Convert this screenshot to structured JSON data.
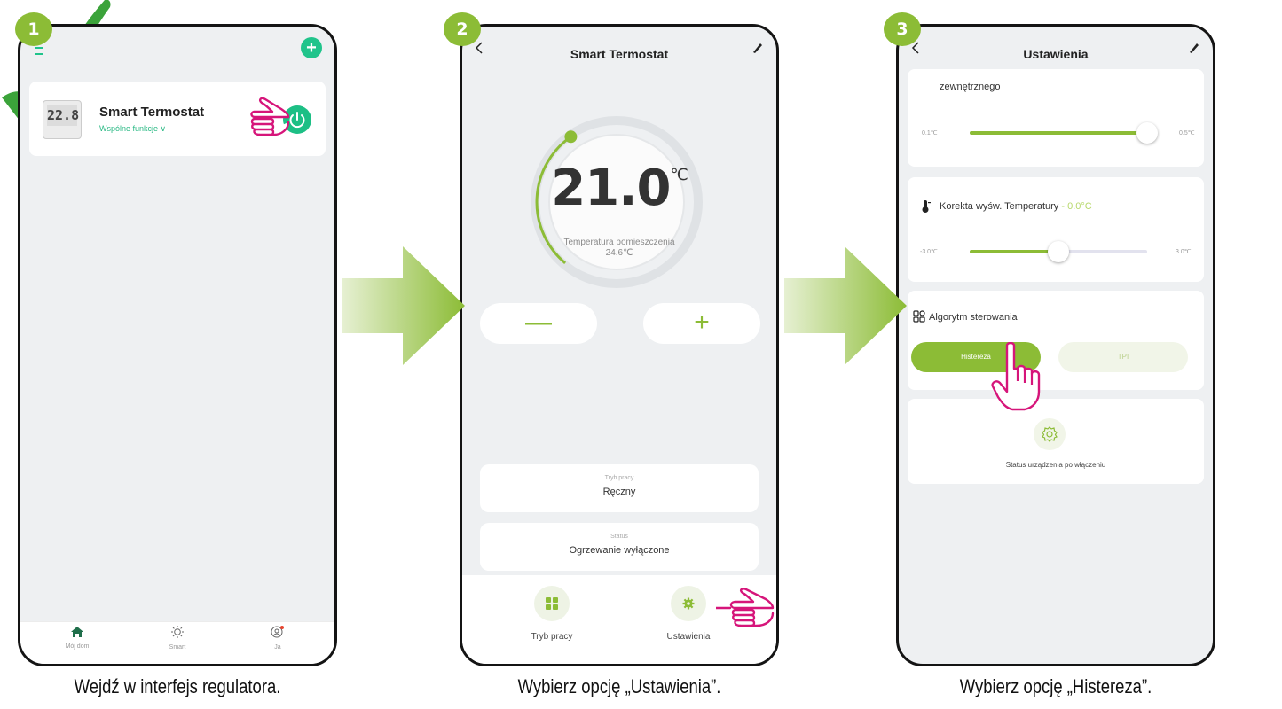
{
  "steps": [
    {
      "number": "1",
      "caption": "Wejdź w interfejs regulatora."
    },
    {
      "number": "2",
      "caption": "Wybierz opcję „Ustawienia”."
    },
    {
      "number": "3",
      "caption": "Wybierz opcję „Histereza”."
    }
  ],
  "phone1": {
    "thermometer_display": "22.8",
    "device_name": "Smart Termostat",
    "device_sub": "Wspólne funkcje ∨",
    "nav": [
      {
        "label": "Mój dom",
        "icon": "home-icon",
        "active": true
      },
      {
        "label": "Smart",
        "icon": "sun-icon",
        "active": false
      },
      {
        "label": "Ja",
        "icon": "profile-icon",
        "active": false
      }
    ]
  },
  "phone2": {
    "title": "Smart Termostat",
    "setpoint": "21.0",
    "unit": "℃",
    "room_label": "Temperatura pomieszczenia",
    "room_value": "24.6℃",
    "minus": "—",
    "plus": "+",
    "mode_label": "Tryb pracy",
    "mode_value": "Ręczny",
    "status_label": "Status",
    "status_value": "Ogrzewanie wyłączone",
    "bottom_mode": "Tryb pracy",
    "bottom_settings": "Ustawienia",
    "setpoint_fraction": 0.35
  },
  "phone3": {
    "title": "Ustawienia",
    "hysteresis_label": "zewnętrznego",
    "hysteresis_min": "0.1℃",
    "hysteresis_max": "0.5℃",
    "hysteresis_fraction": 1.0,
    "correction_label": "Korekta wyśw. Temperatury",
    "correction_value": "- 0.0°C",
    "correction_min": "-3.0℃",
    "correction_max": "3.0℃",
    "correction_fraction": 0.5,
    "algorithm_label": "Algorytm sterowania",
    "option_active": "Histereza",
    "option_inactive": "TPI",
    "power_status_label": "Status urządzenia po włączeniu"
  },
  "colors": {
    "accent_green": "#8cbc36",
    "power_green": "#1dbf85",
    "pointer_pink": "#d6157a"
  }
}
